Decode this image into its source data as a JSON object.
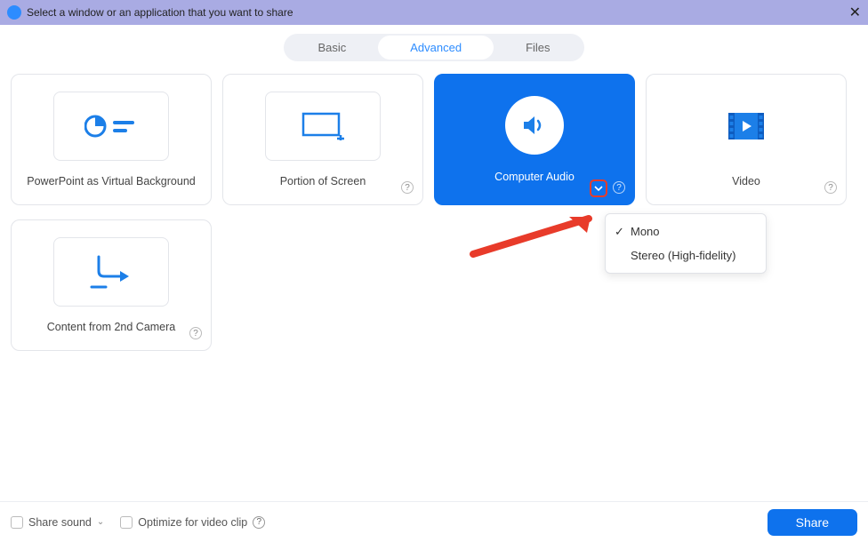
{
  "window": {
    "title": "Select a window or an application that you want to share"
  },
  "tabs": {
    "basic": "Basic",
    "advanced": "Advanced",
    "files": "Files"
  },
  "cards": {
    "ppt": "PowerPoint as Virtual Background",
    "portion": "Portion of Screen",
    "audio": "Computer Audio",
    "video": "Video",
    "cam": "Content from 2nd Camera"
  },
  "popup": {
    "mono": "Mono",
    "stereo": "Stereo (High-fidelity)"
  },
  "bottom": {
    "sound": "Share sound",
    "optimize": "Optimize for video clip",
    "share": "Share"
  }
}
